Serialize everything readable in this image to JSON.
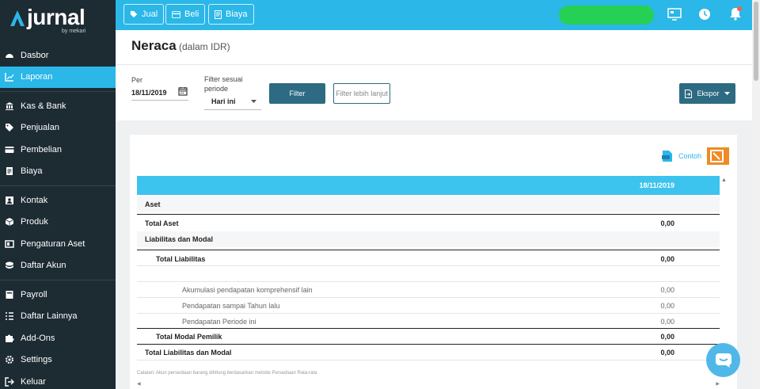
{
  "brand": {
    "name": "jurnal",
    "sub": "by mekari"
  },
  "sidebar": {
    "items": [
      {
        "label": "Dasbor",
        "icon": "dashboard-icon"
      },
      {
        "label": "Laporan",
        "icon": "chart-icon",
        "active": true
      },
      {
        "label": "Kas & Bank",
        "icon": "bank-icon"
      },
      {
        "label": "Penjualan",
        "icon": "tag-icon"
      },
      {
        "label": "Pembelian",
        "icon": "card-icon"
      },
      {
        "label": "Biaya",
        "icon": "receipt-icon"
      },
      {
        "label": "Kontak",
        "icon": "contact-icon"
      },
      {
        "label": "Produk",
        "icon": "box-icon"
      },
      {
        "label": "Pengaturan Aset",
        "icon": "asset-icon"
      },
      {
        "label": "Daftar Akun",
        "icon": "coins-icon"
      },
      {
        "label": "Payroll",
        "icon": "payroll-icon"
      },
      {
        "label": "Daftar Lainnya",
        "icon": "list-icon"
      },
      {
        "label": "Add-Ons",
        "icon": "puzzle-icon"
      },
      {
        "label": "Settings",
        "icon": "gear-icon"
      },
      {
        "label": "Keluar",
        "icon": "logout-icon"
      }
    ]
  },
  "topbar": {
    "jual": "Jual",
    "beli": "Beli",
    "biaya": "Biaya"
  },
  "header": {
    "title": "Neraca",
    "subtitle": "(dalam IDR)"
  },
  "filters": {
    "per_label": "Per",
    "date": "18/11/2019",
    "period_label_1": "Filter sesuai",
    "period_label_2": "periode",
    "period_value": "Hari ini",
    "filter_button": "Filter",
    "more_placeholder": "Filter lebih lanjut",
    "export_button": "Ekspor"
  },
  "report": {
    "contoh": "Contoh",
    "column_date": "18/11/2019",
    "rows": {
      "aset": "Aset",
      "total_aset": "Total Aset",
      "total_aset_val": "0,00",
      "liab_modal": "Liabilitas dan Modal",
      "total_liab": "Total Liabilitas",
      "total_liab_val": "0,00",
      "akum": "Akumulasi pendapatan komprehensif lain",
      "akum_val": "0,00",
      "pend_lalu": "Pendapatan sampai Tahun lalu",
      "pend_lalu_val": "0,00",
      "pend_ini": "Pendapatan Periode ini",
      "pend_ini_val": "0,00",
      "total_modal": "Total Modal Pemilik",
      "total_modal_val": "0,00",
      "total_lm": "Total Liabilitas dan Modal",
      "total_lm_val": "0,00"
    },
    "note": "Catatan: Akun persediaan barang dihitung berdasarkan metode Persediaan Rata-rata"
  },
  "colors": {
    "accent": "#2bb7e8",
    "sidebar": "#1d2b33",
    "button": "#2d6b82"
  }
}
